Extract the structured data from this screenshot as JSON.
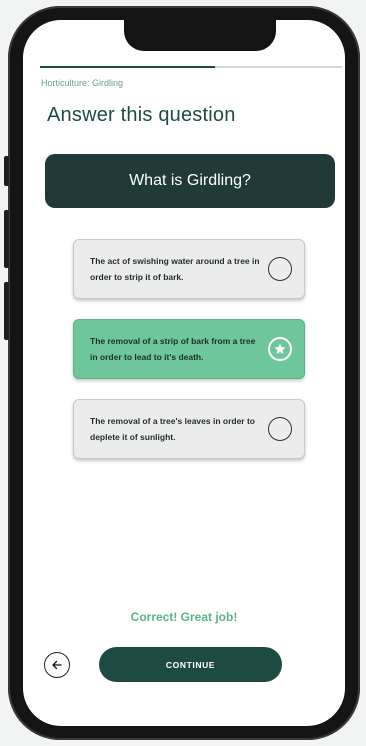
{
  "progress": {
    "fraction": 0.58
  },
  "breadcrumb": "Horticulture: Girdling",
  "title": "Answer this question",
  "question": "What is Girdling?",
  "options": [
    {
      "label": "The act of swishing water around a tree in order to strip it of bark.",
      "selected": false
    },
    {
      "label": "The removal of a strip of bark from a tree in order to lead to it's death.",
      "selected": true
    },
    {
      "label": "The removal of a tree's leaves in order to deplete it of sunlight.",
      "selected": false
    }
  ],
  "feedback": "Correct! Great job!",
  "continue_label": "CONTINUE",
  "icons": {
    "back": "arrow-left-icon",
    "selected": "star-icon"
  },
  "colors": {
    "primary": "#1f4a44",
    "accent": "#6dc79b",
    "feedback": "#5bb287"
  }
}
